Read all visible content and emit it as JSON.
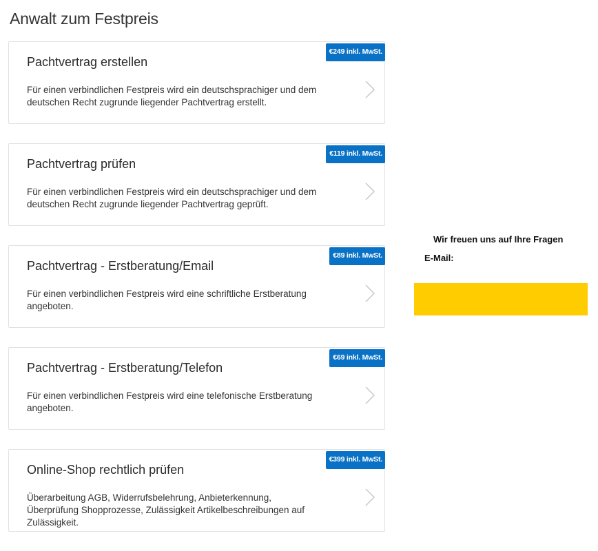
{
  "page": {
    "title": "Anwalt zum Festpreis"
  },
  "offers": [
    {
      "title": "Pachtvertrag erstellen",
      "description": "Für einen verbindlichen Festpreis wird ein deutschsprachiger und dem deutschen Recht zugrunde liegender Pachtvertrag erstellt.",
      "price": "€249 inkl. MwSt."
    },
    {
      "title": "Pachtvertrag prüfen",
      "description": "Für einen verbindlichen Festpreis wird ein deutschsprachiger und dem deutschen Recht zugrunde liegender Pachtvertrag geprüft.",
      "price": "€119 inkl. MwSt."
    },
    {
      "title": "Pachtvertrag - Erstberatung/Email",
      "description": "Für einen verbindlichen Festpreis wird eine schriftliche Erstberatung angeboten.",
      "price": "€89 inkl. MwSt."
    },
    {
      "title": "Pachtvertrag - Erstberatung/Telefon",
      "description": "Für einen verbindlichen Festpreis wird eine telefonische Erstberatung angeboten.",
      "price": "€69 inkl. MwSt."
    },
    {
      "title": "Online-Shop rechtlich prüfen",
      "description": "Überarbeitung AGB, Widerrufsbelehrung, Anbieterkennung, Überprüfung Shopprozesse, Zulässigkeit Artikelbeschreibungen auf Zulässigkeit.",
      "price": "€399 inkl. MwSt."
    }
  ],
  "contact": {
    "heading": "Wir freuen uns auf Ihre Fragen",
    "email_label": "E-Mail:",
    "button_color": "#ffcc00"
  },
  "colors": {
    "badge": "#0a72c6",
    "card_border": "#e1e1e1",
    "accent": "#ffcc00"
  },
  "icons": {
    "card_arrow": "chevron-right-icon"
  }
}
